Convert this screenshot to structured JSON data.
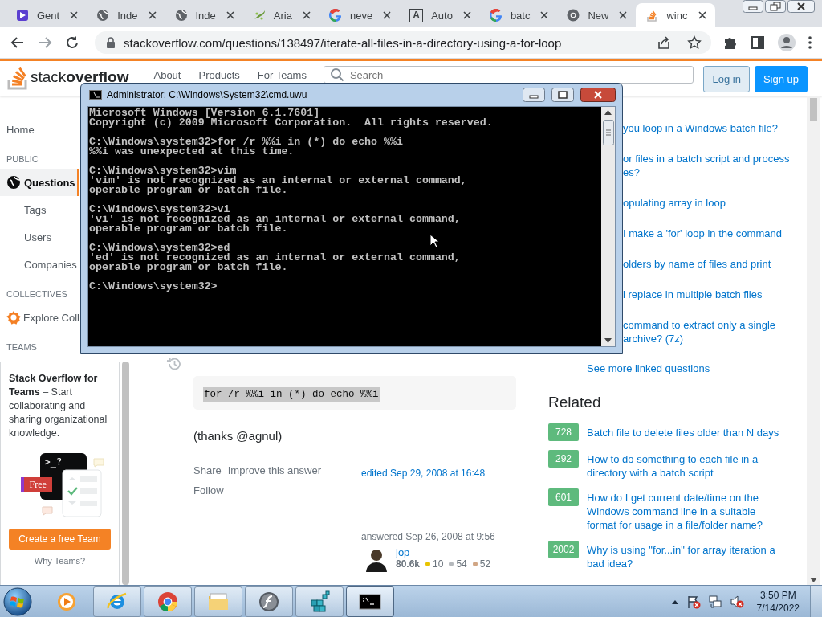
{
  "browser": {
    "tabs": [
      {
        "label": "Gent",
        "selected": false
      },
      {
        "label": "Inde",
        "selected": false
      },
      {
        "label": "Inde",
        "selected": false
      },
      {
        "label": "Aria",
        "selected": false
      },
      {
        "label": "neve",
        "selected": false
      },
      {
        "label": "Auto",
        "selected": false,
        "icon_text": "A"
      },
      {
        "label": "batc",
        "selected": false
      },
      {
        "label": "New",
        "selected": false
      },
      {
        "label": "winc",
        "selected": true
      }
    ],
    "url": "stackoverflow.com/questions/138497/iterate-all-files-in-a-directory-using-a-for-loop"
  },
  "site_header": {
    "logo": "stack**overflow**",
    "nav": [
      "About",
      "Products",
      "For Teams"
    ],
    "search": {
      "placeholder": "Search"
    },
    "buttons": [
      {
        "label": "Log in",
        "kind": "secondary"
      },
      {
        "label": "Sign up",
        "kind": "primary"
      }
    ]
  },
  "sidebar": {
    "items": [
      {
        "kind": "link",
        "label": "Home",
        "selected": false
      },
      {
        "kind": "heading",
        "label": "PUBLIC"
      },
      {
        "kind": "primary",
        "label": "Questions",
        "selected": true
      },
      {
        "kind": "sublink",
        "label": "Tags",
        "selected": false
      },
      {
        "kind": "sublink",
        "label": "Users",
        "selected": false
      },
      {
        "kind": "sublink",
        "label": "Companies",
        "selected": false
      },
      {
        "kind": "heading",
        "label": "COLLECTIVES"
      },
      {
        "kind": "collective",
        "label": "Explore Coll",
        "selected": false
      },
      {
        "kind": "heading",
        "label": "TEAMS"
      }
    ],
    "teams_card": {
      "text": "**Stack Overflow for Teams** – Start collaborating and sharing organizational knowledge.",
      "prompt": ">_?",
      "badge": "Free",
      "button": "Create a free Team",
      "link": "Why Teams?"
    }
  },
  "answer": {
    "code": "for /r %%i in (*) do echo %%i",
    "code_selected": true,
    "text": "(thanks @agnul)",
    "menu": [
      "Share",
      "Improve this answer",
      "Follow"
    ],
    "edited": "edited Sep 29, 2008 at 16:48",
    "answered": "answered Sep 26, 2008 at 9:56",
    "user": {
      "name": "jop",
      "reputation": "80.6k",
      "badges": [
        {
          "count": "10",
          "color": "#e8c400"
        },
        {
          "count": "54",
          "color": "#b4b8bc"
        },
        {
          "count": "52",
          "color": "#d1a684"
        }
      ]
    }
  },
  "linked": {
    "items": [
      "you loop in a Windows batch file?",
      "or files in a batch script and process\nes?",
      "opulating array in loop",
      "I make a 'for' loop in the command",
      "olders by name of files and print",
      "l replace in multiple batch files",
      "command to extract only a single\narchive? (7z)"
    ],
    "more": "See more linked questions"
  },
  "related": {
    "title": "Related",
    "items": [
      {
        "score": "728",
        "title": "Batch file to delete files older than N days"
      },
      {
        "score": "292",
        "title": "How to do something to each file in a directory with a batch script"
      },
      {
        "score": "601",
        "title": "How do I get current date/time on the Windows command line in a suitable format for usage in a file/folder name?"
      },
      {
        "score": "2002",
        "title": "Why is using \"for...in\" for array iteration a bad idea?"
      }
    ]
  },
  "cmd_window": {
    "title": "Administrator: C:\\Windows\\System32\\cmd.uwu",
    "blocks": [
      [
        "Microsoft Windows [Version 6.1.7601]",
        "Copyright (c) 2009 Microsoft Corporation.  All rights reserved."
      ],
      [
        "C:\\Windows\\system32>for /r %%i in (*) do echo %%i",
        "%%i was unexpected at this time."
      ],
      [
        "C:\\Windows\\system32>vim",
        "'vim' is not recognized as an internal or external command,",
        "operable program or batch file."
      ],
      [
        "C:\\Windows\\system32>vi",
        "'vi' is not recognized as an internal or external command,",
        "operable program or batch file."
      ],
      [
        "C:\\Windows\\system32>ed",
        "'ed' is not recognized as an internal or external command,",
        "operable program or batch file."
      ],
      [
        "C:\\Windows\\system32>"
      ]
    ]
  },
  "taskbar": {
    "apps": [
      {
        "running": false,
        "selected": false
      },
      {
        "running": true,
        "selected": false
      },
      {
        "running": true,
        "selected": false
      },
      {
        "running": true,
        "selected": false
      },
      {
        "running": true,
        "selected": false
      },
      {
        "running": true,
        "selected": false
      },
      {
        "running": true,
        "selected": true
      }
    ],
    "clock": {
      "time": "3:50 PM",
      "date": "7/14/2022"
    }
  }
}
